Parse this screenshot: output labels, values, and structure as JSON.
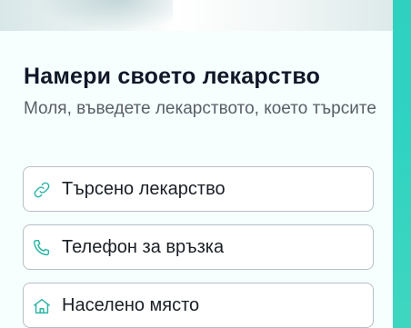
{
  "header": {
    "title": "Намери своето лекарство",
    "subtitle": "Моля, въведете лекарството, което търсите"
  },
  "fields": [
    {
      "label": "Търсено лекарство",
      "icon": "link-icon"
    },
    {
      "label": "Телефон за връзка",
      "icon": "phone-icon"
    },
    {
      "label": "Населено място",
      "icon": "home-icon"
    }
  ],
  "colors": {
    "accent": "#2fd0c0",
    "icon": "#2cb5a5",
    "card_background": "#f6fefe",
    "field_border": "#b7bfc6"
  }
}
